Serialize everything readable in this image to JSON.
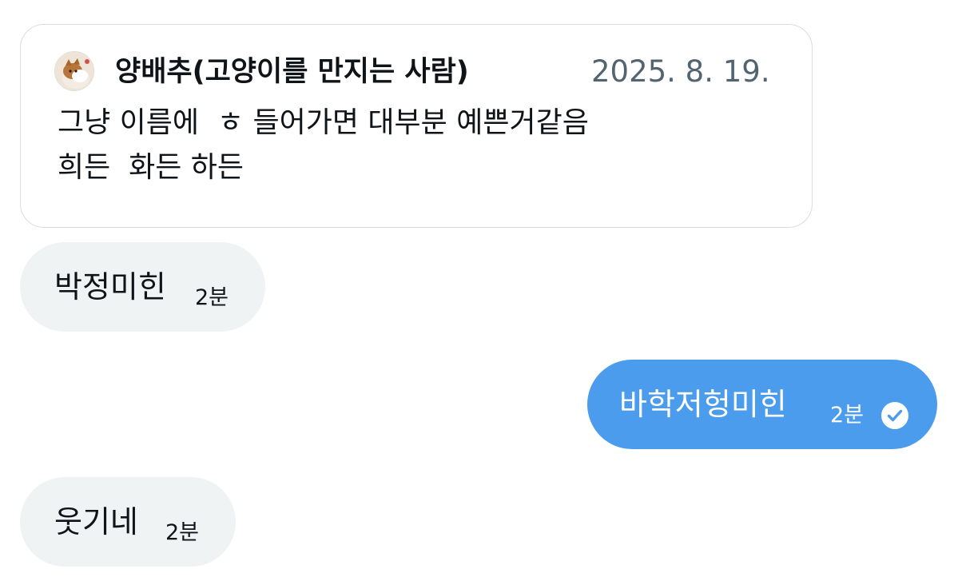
{
  "quoted_post": {
    "author": "양배추(고양이를 만지는 사람)",
    "date": "2025. 8. 19.",
    "lines": [
      "그냥 이름에  ㅎ 들어가면 대부분 예쁜거같음",
      "희든  화든 하든"
    ]
  },
  "messages": [
    {
      "direction": "incoming",
      "text": "박정미힌",
      "time": "2분"
    },
    {
      "direction": "outgoing",
      "text": "바학저헝미힌",
      "time": "2분",
      "status": "read"
    },
    {
      "direction": "incoming",
      "text": "웃기네",
      "time": "2분"
    }
  ],
  "colors": {
    "outgoing_bubble": "#4b9ced",
    "incoming_bubble": "#eff3f4",
    "card_border": "#d9dde1",
    "secondary_text": "#536471"
  },
  "icons": {
    "avatar": "cat-avatar",
    "read_status": "check-circle-icon"
  }
}
